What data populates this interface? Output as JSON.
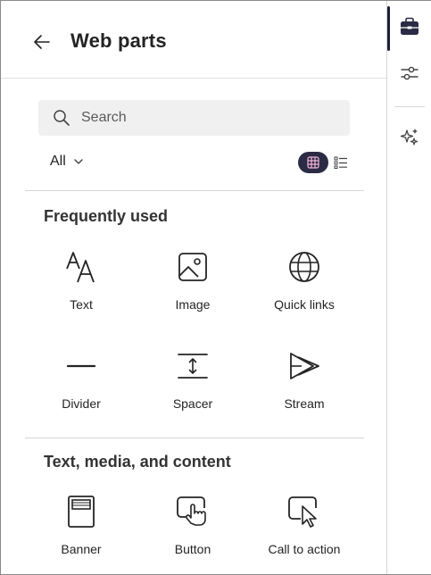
{
  "panel": {
    "title": "Web parts",
    "search": {
      "placeholder": "Search"
    },
    "filter": {
      "label": "All"
    }
  },
  "sections": [
    {
      "title": "Frequently used",
      "items": [
        {
          "label": "Text",
          "icon": "text-icon"
        },
        {
          "label": "Image",
          "icon": "image-icon"
        },
        {
          "label": "Quick links",
          "icon": "globe-icon"
        },
        {
          "label": "Divider",
          "icon": "divider-icon"
        },
        {
          "label": "Spacer",
          "icon": "spacer-icon"
        },
        {
          "label": "Stream",
          "icon": "stream-icon"
        }
      ]
    },
    {
      "title": "Text, media, and content",
      "items": [
        {
          "label": "Banner",
          "icon": "banner-icon"
        },
        {
          "label": "Button",
          "icon": "button-icon"
        },
        {
          "label": "Call to action",
          "icon": "call-to-action-icon"
        }
      ]
    }
  ],
  "rail": {
    "items": [
      {
        "icon": "toolbox-icon",
        "active": true
      },
      {
        "icon": "sliders-icon",
        "active": false
      },
      {
        "icon": "sparkle-icon",
        "active": false
      }
    ]
  },
  "colors": {
    "accent": "#2b2b45",
    "text": "#242424",
    "divider": "#d6d6d6",
    "search_bg": "#f0f0f0"
  }
}
